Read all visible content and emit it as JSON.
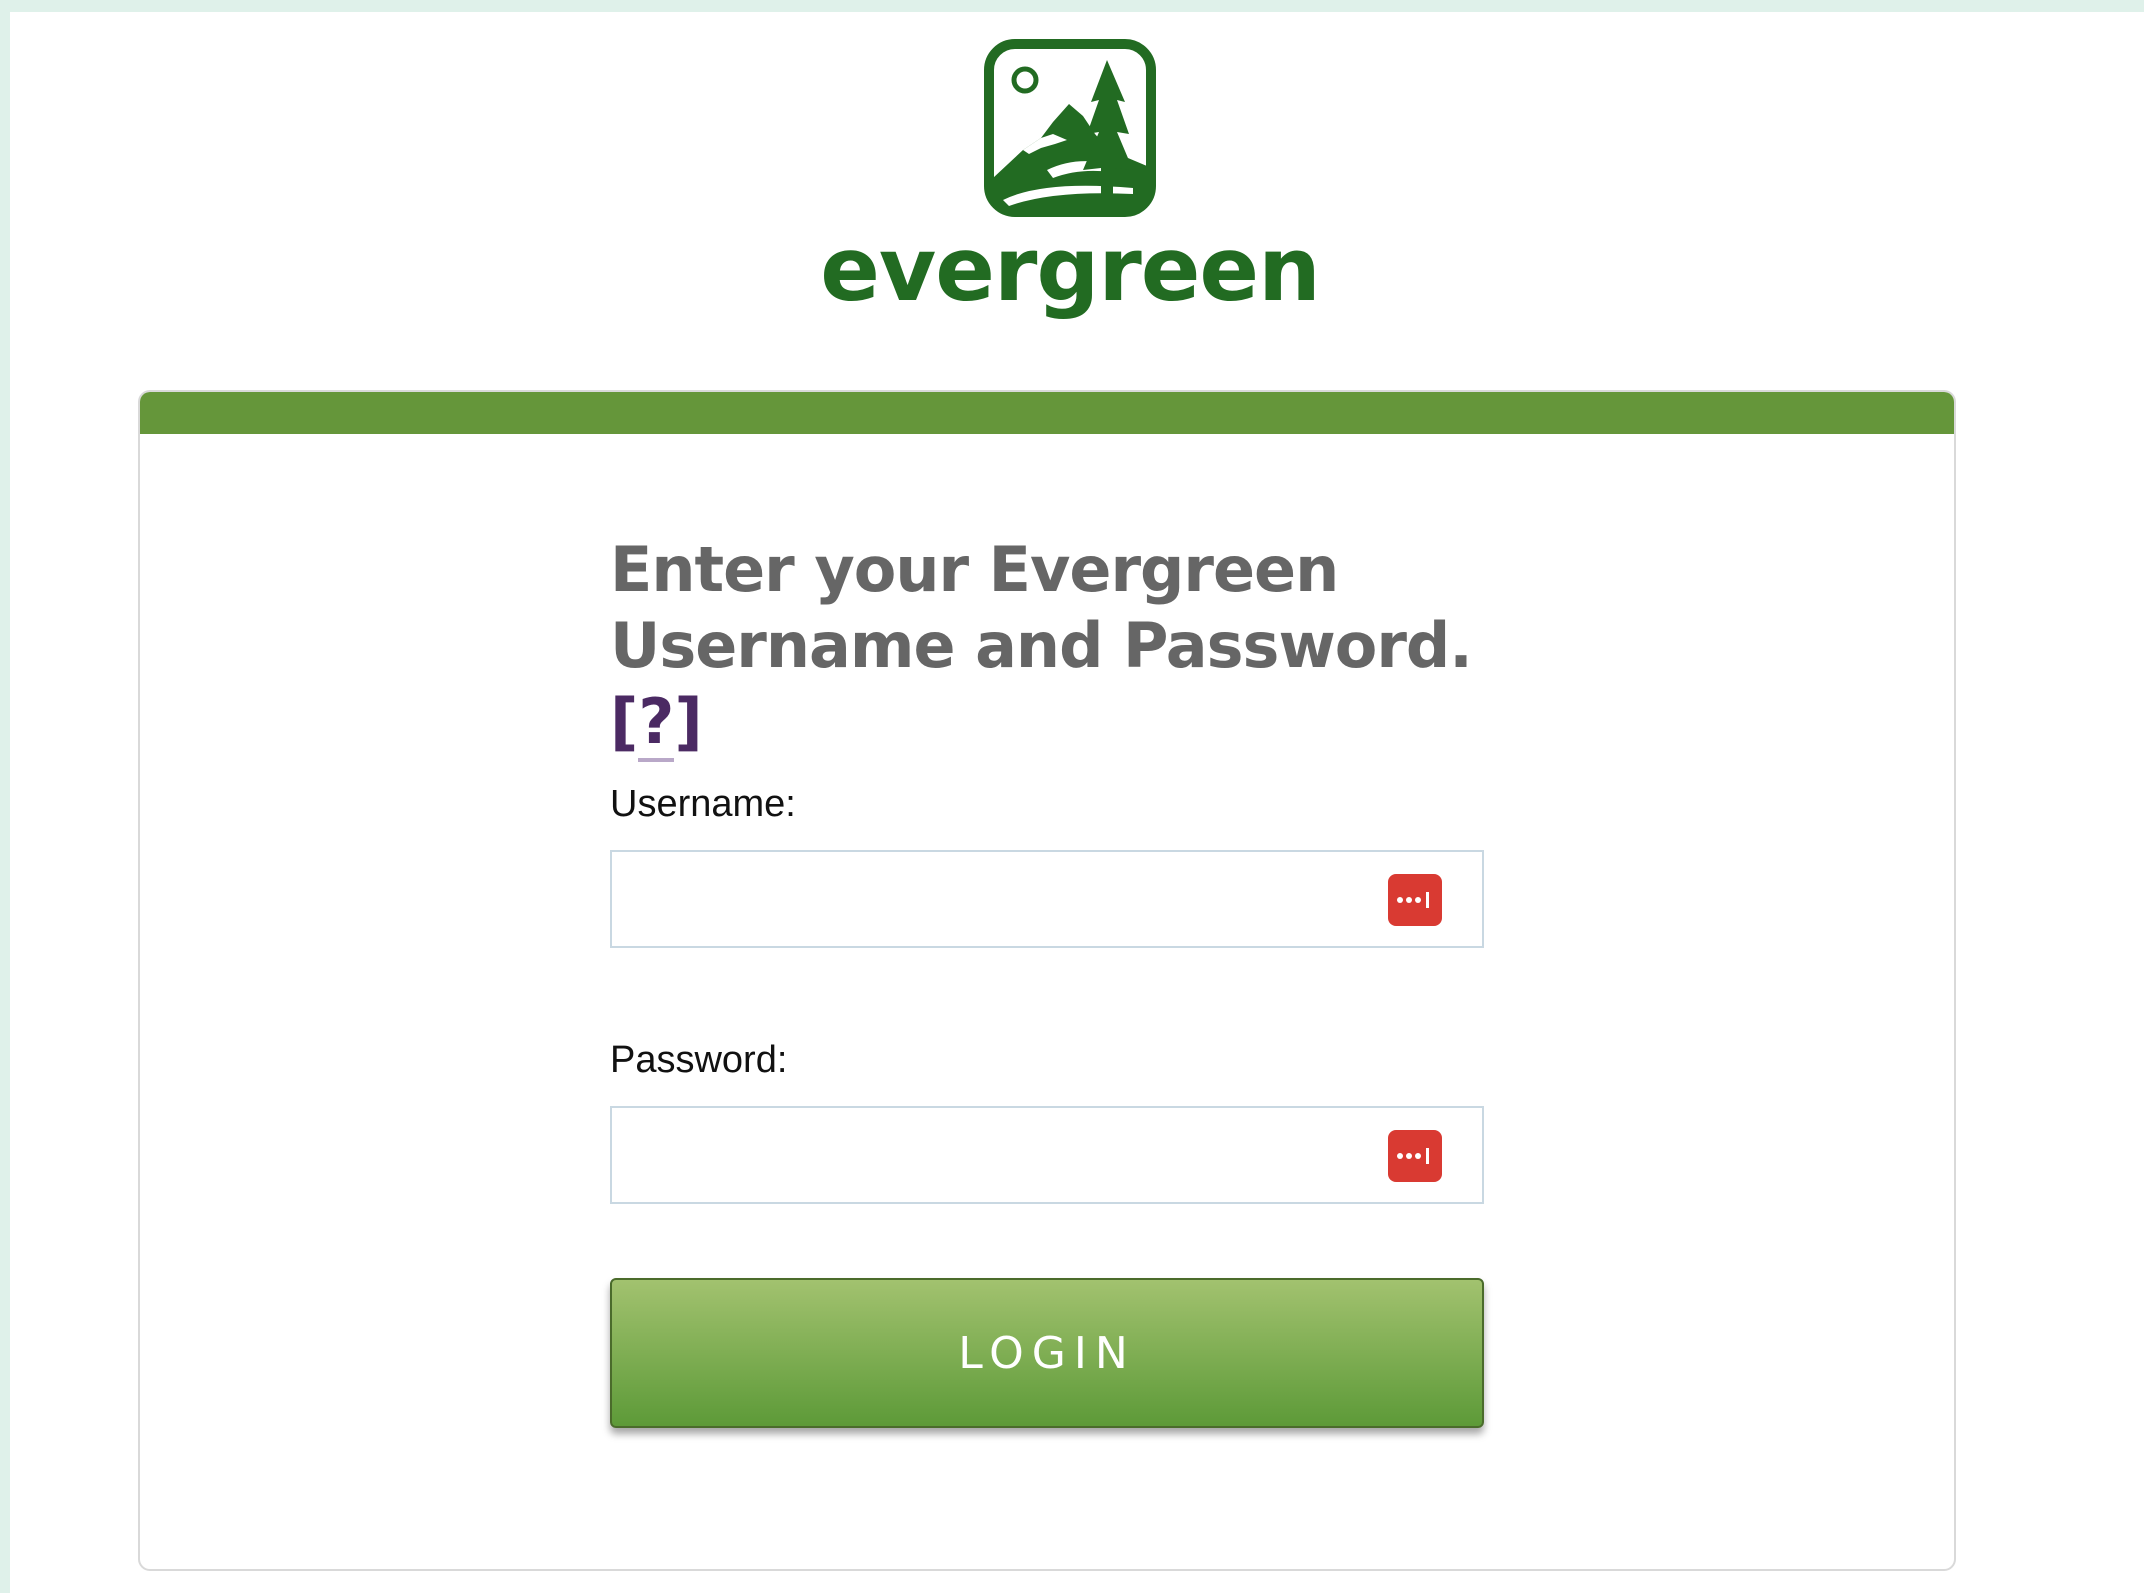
{
  "colors": {
    "brand_green": "#226b22",
    "card_topbar": "#65963a",
    "heading_gray": "#666666",
    "help_purple": "#4b2a63",
    "button_top": "#a2c26f",
    "button_bottom": "#5d9a38",
    "password_manager_red": "#d93a32"
  },
  "logo": {
    "icon": "evergreen-mountain-tree-logo",
    "text": "evergreen"
  },
  "form": {
    "heading_line1": "Enter your Evergreen",
    "heading_line2": "Username and Password.",
    "help_text_open": "[",
    "help_text_q": "?",
    "help_text_close": "]",
    "username_label": "Username:",
    "username_value": "",
    "password_label": "Password:",
    "password_value": "",
    "password_manager_icon": "password-manager-icon",
    "login_label": "LOGIN"
  }
}
